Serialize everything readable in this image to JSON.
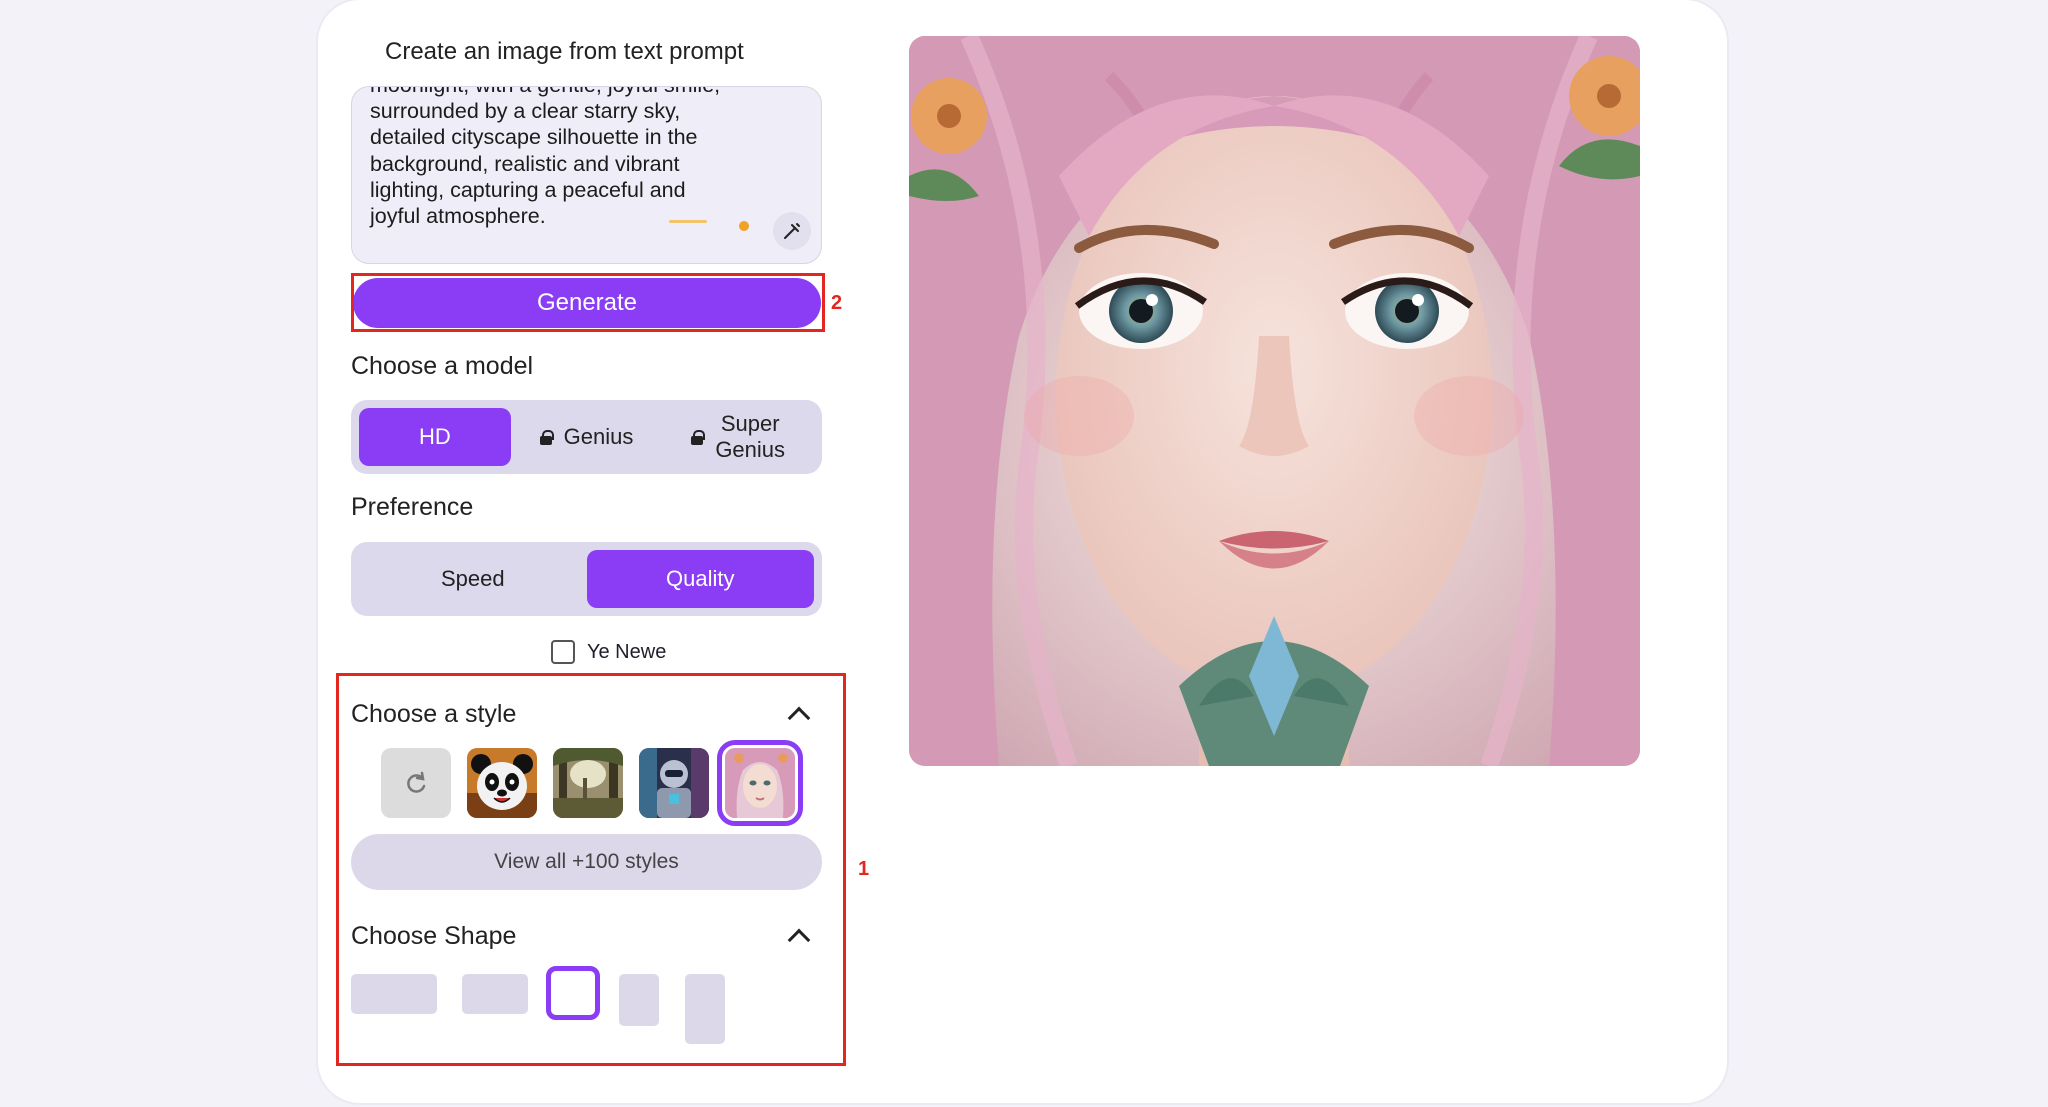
{
  "panel": {
    "title": "Create an image from text prompt",
    "prompt_text": "moonlight, with a gentle, joyful smile,\nsurrounded by a clear starry sky,\ndetailed cityscape silhouette in the\nbackground, realistic and vibrant\nlighting, capturing a peaceful and\njoyful atmosphere.",
    "generate_label": "Generate",
    "model_label": "Choose a model",
    "models": [
      {
        "label": "HD",
        "locked": false,
        "active": true
      },
      {
        "label": "Genius",
        "locked": true,
        "active": false
      },
      {
        "label": "Super\nGenius",
        "locked": true,
        "active": false
      }
    ],
    "preference_label": "Preference",
    "preferences": [
      {
        "label": "Speed",
        "active": false
      },
      {
        "label": "Quality",
        "active": true
      }
    ],
    "checkbox_label": "Ye Newe",
    "style_label": "Choose a style",
    "view_all_label": "View all +100 styles",
    "shape_label": "Choose Shape"
  },
  "annotations": {
    "box2_number": "2",
    "box1_number": "1"
  },
  "colors": {
    "accent": "#8a3df4",
    "annotation": "#e3261f"
  }
}
